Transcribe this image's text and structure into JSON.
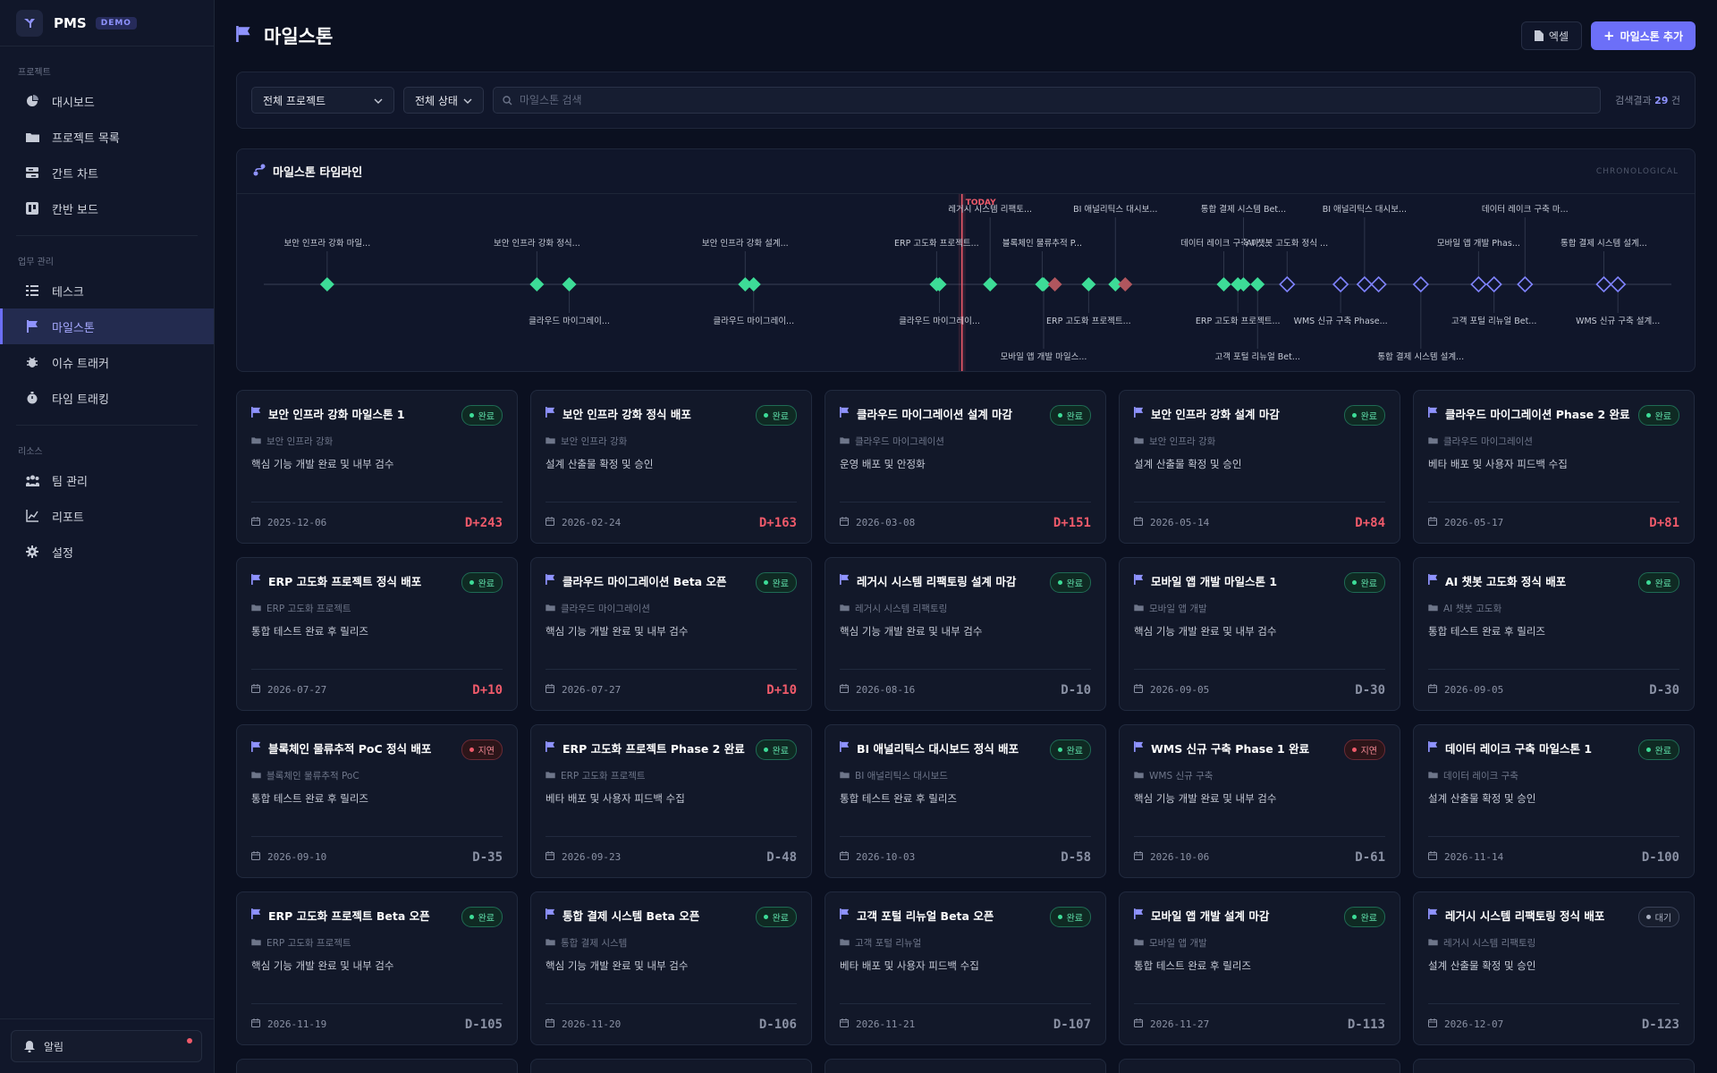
{
  "brand": {
    "name": "PMS",
    "badge": "DEMO"
  },
  "sidebar": {
    "sections": [
      {
        "label": "프로젝트",
        "items": [
          {
            "label": "대시보드",
            "icon": "dashboard-icon"
          },
          {
            "label": "프로젝트 목록",
            "icon": "folder-icon"
          },
          {
            "label": "간트 차트",
            "icon": "gantt-icon"
          },
          {
            "label": "칸반 보드",
            "icon": "kanban-icon"
          }
        ]
      },
      {
        "label": "업무 관리",
        "items": [
          {
            "label": "테스크",
            "icon": "task-list-icon"
          },
          {
            "label": "마일스톤",
            "icon": "flag-icon",
            "active": true
          },
          {
            "label": "이슈 트래커",
            "icon": "bug-icon"
          },
          {
            "label": "타임 트래킹",
            "icon": "timer-icon"
          }
        ]
      },
      {
        "label": "리소스",
        "items": [
          {
            "label": "팀 관리",
            "icon": "team-icon"
          },
          {
            "label": "리포트",
            "icon": "chart-line-icon"
          },
          {
            "label": "설정",
            "icon": "gear-icon"
          }
        ]
      }
    ],
    "alert_label": "알림"
  },
  "header": {
    "title": "마일스톤",
    "excel_label": "엑셀",
    "add_label": "마일스톤 추가"
  },
  "filters": {
    "project": "전체 프로젝트",
    "status": "전체 상태",
    "search_placeholder": "마일스톤 검색",
    "result_prefix": "검색결과",
    "result_count": "29",
    "result_suffix": "건"
  },
  "timeline": {
    "title": "마일스톤 타임라인",
    "tag": "CHRONOLOGICAL",
    "today_label": "TODAY",
    "colors": {
      "done": "#3ddc97",
      "late": "#b0565e",
      "pending": "#7f83ff",
      "today": "#ef5a6a"
    },
    "today_pos": 0.496,
    "markers": [
      {
        "pos": 0.045,
        "status": "done",
        "label": "보안 인프라 강화 마일...",
        "side": "up",
        "tier": 1
      },
      {
        "pos": 0.194,
        "status": "done",
        "label": "보안 인프라 강화 정식...",
        "side": "up",
        "tier": 1
      },
      {
        "pos": 0.217,
        "status": "done",
        "label": "클라우드 마이그레이...",
        "side": "down",
        "tier": 1
      },
      {
        "pos": 0.342,
        "status": "done",
        "label": "보안 인프라 강화 설계...",
        "side": "up",
        "tier": 1
      },
      {
        "pos": 0.348,
        "status": "done",
        "label": "클라우드 마이그레이...",
        "side": "down",
        "tier": 1
      },
      {
        "pos": 0.478,
        "status": "done",
        "label": "ERP 고도화 프로젝트...",
        "side": "up",
        "tier": 1
      },
      {
        "pos": 0.48,
        "status": "done",
        "label": "클라우드 마이그레이...",
        "side": "down",
        "tier": 1
      },
      {
        "pos": 0.516,
        "status": "done",
        "label": "레거시 시스템 리팩토...",
        "side": "up",
        "tier": 2
      },
      {
        "pos": 0.553,
        "status": "done",
        "label": "블록체인 물류추적 P...",
        "side": "up",
        "tier": 1
      },
      {
        "pos": 0.554,
        "status": "done",
        "label": "모바일 앱 개발 마일스...",
        "side": "down",
        "tier": 2
      },
      {
        "pos": 0.562,
        "status": "late",
        "label": "",
        "side": "up",
        "tier": 1
      },
      {
        "pos": 0.586,
        "status": "done",
        "label": "ERP 고도화 프로젝트...",
        "side": "down",
        "tier": 1
      },
      {
        "pos": 0.605,
        "status": "done",
        "label": "BI 애널리틱스 대시보...",
        "side": "up",
        "tier": 2
      },
      {
        "pos": 0.612,
        "status": "late",
        "label": "",
        "side": "up",
        "tier": 1
      },
      {
        "pos": 0.682,
        "status": "done",
        "label": "데이터 레이크 구축 마...",
        "side": "up",
        "tier": 1
      },
      {
        "pos": 0.692,
        "status": "done",
        "label": "ERP 고도화 프로젝트...",
        "side": "down",
        "tier": 1
      },
      {
        "pos": 0.696,
        "status": "done",
        "label": "통합 결제 시스템 Bet...",
        "side": "up",
        "tier": 2
      },
      {
        "pos": 0.706,
        "status": "done",
        "label": "고객 포털 리뉴얼 Bet...",
        "side": "down",
        "tier": 2
      },
      {
        "pos": 0.727,
        "status": "pending",
        "label": "AI 챗봇 고도화 정식 ...",
        "side": "up",
        "tier": 1
      },
      {
        "pos": 0.765,
        "status": "pending",
        "label": "WMS 신규 구축 Phase...",
        "side": "down",
        "tier": 1
      },
      {
        "pos": 0.782,
        "status": "pending",
        "label": "BI 애널리틱스 대시보...",
        "side": "up",
        "tier": 2
      },
      {
        "pos": 0.792,
        "status": "pending",
        "label": "",
        "side": "up",
        "tier": 1
      },
      {
        "pos": 0.822,
        "status": "pending",
        "label": "통합 결제 시스템 설계...",
        "side": "down",
        "tier": 2
      },
      {
        "pos": 0.863,
        "status": "pending",
        "label": "모바일 앱 개발 Phas...",
        "side": "up",
        "tier": 1
      },
      {
        "pos": 0.874,
        "status": "pending",
        "label": "고객 포털 리뉴얼 Bet...",
        "side": "down",
        "tier": 1
      },
      {
        "pos": 0.896,
        "status": "pending",
        "label": "데이터 레이크 구축 마...",
        "side": "up",
        "tier": 2
      },
      {
        "pos": 0.952,
        "status": "pending",
        "label": "통합 결제 시스템 설계...",
        "side": "up",
        "tier": 1
      },
      {
        "pos": 0.962,
        "status": "pending",
        "label": "WMS 신규 구축 설계...",
        "side": "down",
        "tier": 1
      }
    ]
  },
  "milestones": [
    {
      "title": "보안 인프라 강화 마일스톤 1",
      "status": "done",
      "status_label": "완료",
      "project": "보안 인프라 강화",
      "desc": "핵심 기능 개발 완료 및 내부 검수",
      "date": "2025-12-06",
      "dday": "D+243",
      "overdue": true
    },
    {
      "title": "보안 인프라 강화 정식 배포",
      "status": "done",
      "status_label": "완료",
      "project": "보안 인프라 강화",
      "desc": "설계 산출물 확정 및 승인",
      "date": "2026-02-24",
      "dday": "D+163",
      "overdue": true
    },
    {
      "title": "클라우드 마이그레이션 설계 마감",
      "status": "done",
      "status_label": "완료",
      "project": "클라우드 마이그레이션",
      "desc": "운영 배포 및 안정화",
      "date": "2026-03-08",
      "dday": "D+151",
      "overdue": true
    },
    {
      "title": "보안 인프라 강화 설계 마감",
      "status": "done",
      "status_label": "완료",
      "project": "보안 인프라 강화",
      "desc": "설계 산출물 확정 및 승인",
      "date": "2026-05-14",
      "dday": "D+84",
      "overdue": true
    },
    {
      "title": "클라우드 마이그레이션 Phase 2 완료",
      "status": "done",
      "status_label": "완료",
      "project": "클라우드 마이그레이션",
      "desc": "베타 배포 및 사용자 피드백 수집",
      "date": "2026-05-17",
      "dday": "D+81",
      "overdue": true
    },
    {
      "title": "ERP 고도화 프로젝트 정식 배포",
      "status": "done",
      "status_label": "완료",
      "project": "ERP 고도화 프로젝트",
      "desc": "통합 테스트 완료 후 릴리즈",
      "date": "2026-07-27",
      "dday": "D+10",
      "overdue": true
    },
    {
      "title": "클라우드 마이그레이션 Beta 오픈",
      "status": "done",
      "status_label": "완료",
      "project": "클라우드 마이그레이션",
      "desc": "핵심 기능 개발 완료 및 내부 검수",
      "date": "2026-07-27",
      "dday": "D+10",
      "overdue": true
    },
    {
      "title": "레거시 시스템 리팩토링 설계 마감",
      "status": "done",
      "status_label": "완료",
      "project": "레거시 시스템 리팩토링",
      "desc": "핵심 기능 개발 완료 및 내부 검수",
      "date": "2026-08-16",
      "dday": "D-10",
      "overdue": false
    },
    {
      "title": "모바일 앱 개발 마일스톤 1",
      "status": "done",
      "status_label": "완료",
      "project": "모바일 앱 개발",
      "desc": "핵심 기능 개발 완료 및 내부 검수",
      "date": "2026-09-05",
      "dday": "D-30",
      "overdue": false
    },
    {
      "title": "AI 챗봇 고도화 정식 배포",
      "status": "done",
      "status_label": "완료",
      "project": "AI 챗봇 고도화",
      "desc": "통합 테스트 완료 후 릴리즈",
      "date": "2026-09-05",
      "dday": "D-30",
      "overdue": false
    },
    {
      "title": "블록체인 물류추적 PoC 정식 배포",
      "status": "late",
      "status_label": "지연",
      "project": "블록체인 물류추적 PoC",
      "desc": "통합 테스트 완료 후 릴리즈",
      "date": "2026-09-10",
      "dday": "D-35",
      "overdue": false
    },
    {
      "title": "ERP 고도화 프로젝트 Phase 2 완료",
      "status": "done",
      "status_label": "완료",
      "project": "ERP 고도화 프로젝트",
      "desc": "베타 배포 및 사용자 피드백 수집",
      "date": "2026-09-23",
      "dday": "D-48",
      "overdue": false
    },
    {
      "title": "BI 애널리틱스 대시보드 정식 배포",
      "status": "done",
      "status_label": "완료",
      "project": "BI 애널리틱스 대시보드",
      "desc": "통합 테스트 완료 후 릴리즈",
      "date": "2026-10-03",
      "dday": "D-58",
      "overdue": false
    },
    {
      "title": "WMS 신규 구축 Phase 1 완료",
      "status": "late",
      "status_label": "지연",
      "project": "WMS 신규 구축",
      "desc": "핵심 기능 개발 완료 및 내부 검수",
      "date": "2026-10-06",
      "dday": "D-61",
      "overdue": false
    },
    {
      "title": "데이터 레이크 구축 마일스톤 1",
      "status": "done",
      "status_label": "완료",
      "project": "데이터 레이크 구축",
      "desc": "설계 산출물 확정 및 승인",
      "date": "2026-11-14",
      "dday": "D-100",
      "overdue": false
    },
    {
      "title": "ERP 고도화 프로젝트 Beta 오픈",
      "status": "done",
      "status_label": "완료",
      "project": "ERP 고도화 프로젝트",
      "desc": "핵심 기능 개발 완료 및 내부 검수",
      "date": "2026-11-19",
      "dday": "D-105",
      "overdue": false
    },
    {
      "title": "통합 결제 시스템 Beta 오픈",
      "status": "done",
      "status_label": "완료",
      "project": "통합 결제 시스템",
      "desc": "핵심 기능 개발 완료 및 내부 검수",
      "date": "2026-11-20",
      "dday": "D-106",
      "overdue": false
    },
    {
      "title": "고객 포털 리뉴얼 Beta 오픈",
      "status": "done",
      "status_label": "완료",
      "project": "고객 포털 리뉴얼",
      "desc": "베타 배포 및 사용자 피드백 수집",
      "date": "2026-11-21",
      "dday": "D-107",
      "overdue": false
    },
    {
      "title": "모바일 앱 개발 설계 마감",
      "status": "done",
      "status_label": "완료",
      "project": "모바일 앱 개발",
      "desc": "통합 테스트 완료 후 릴리즈",
      "date": "2026-11-27",
      "dday": "D-113",
      "overdue": false
    },
    {
      "title": "레거시 시스템 리팩토링 정식 배포",
      "status": "wait",
      "status_label": "대기",
      "project": "레거시 시스템 리팩토링",
      "desc": "설계 산출물 확정 및 승인",
      "date": "2026-12-07",
      "dday": "D-123",
      "overdue": false
    }
  ]
}
